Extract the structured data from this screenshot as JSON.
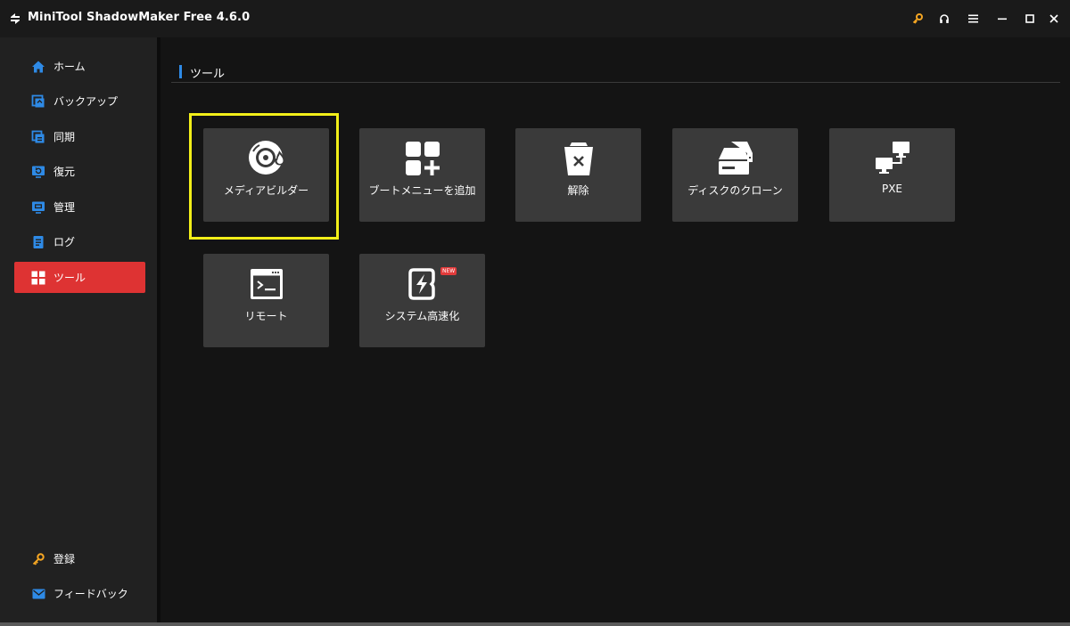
{
  "app": {
    "title": "MiniTool ShadowMaker Free 4.6.0"
  },
  "titlebar": {
    "icons": [
      "key-icon",
      "headset-icon",
      "menu-icon",
      "minimize-icon",
      "maximize-icon",
      "close-icon"
    ],
    "key_color": "#f5a623"
  },
  "sidebar": {
    "items": [
      {
        "label": "ホーム",
        "icon": "home-icon"
      },
      {
        "label": "バックアップ",
        "icon": "backup-icon"
      },
      {
        "label": "同期",
        "icon": "sync-icon"
      },
      {
        "label": "復元",
        "icon": "restore-icon"
      },
      {
        "label": "管理",
        "icon": "manage-icon"
      },
      {
        "label": "ログ",
        "icon": "log-icon"
      },
      {
        "label": "ツール",
        "icon": "tools-icon",
        "active": true
      }
    ],
    "bottom": [
      {
        "label": "登録",
        "icon": "key-icon"
      },
      {
        "label": "フィードバック",
        "icon": "mail-icon"
      }
    ],
    "active_color": "#de3333",
    "icon_color": "#2e8ae6"
  },
  "main": {
    "section_title": "ツール",
    "tools": [
      {
        "label": "メディアビルダー",
        "icon": "media-builder-icon",
        "selected": true
      },
      {
        "label": "ブートメニューを追加",
        "icon": "add-boot-menu-icon"
      },
      {
        "label": "解除",
        "icon": "unmount-icon"
      },
      {
        "label": "ディスクのクローン",
        "icon": "clone-disk-icon"
      },
      {
        "label": "PXE",
        "icon": "pxe-icon"
      },
      {
        "label": "リモート",
        "icon": "remote-icon"
      },
      {
        "label": "システム高速化",
        "icon": "system-boost-icon",
        "badge": "NEW"
      }
    ],
    "highlight_color": "#f2ef19"
  }
}
